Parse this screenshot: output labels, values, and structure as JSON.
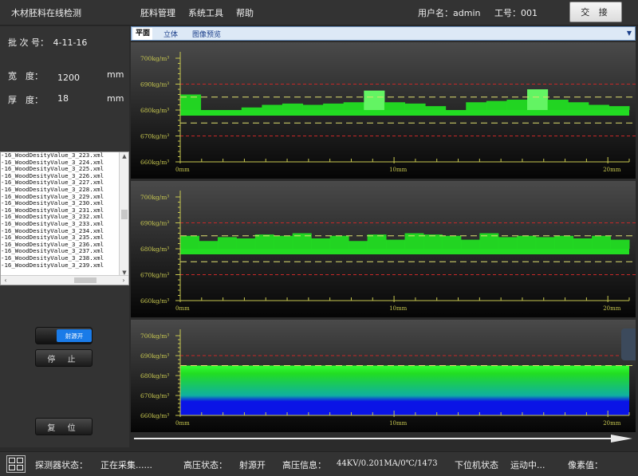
{
  "app": {
    "title": "木材胚料在线检测",
    "menus": [
      "胚料管理",
      "系统工具",
      "帮助"
    ],
    "user_label": "用户名：admin",
    "worker_label": "工号：001",
    "switch_button": "交 接"
  },
  "batch": {
    "label": "批 次 号：",
    "value": "4-11-16",
    "width_label": "宽　度：",
    "width_value": "1200",
    "thickness_label": "厚　度：",
    "thickness_value": "18",
    "unit": "mm"
  },
  "file_list": [
    "-16_WoodDesityValue_3_223.xml",
    "-16_WoodDesityValue_3_224.xml",
    "-16_WoodDesityValue_3_225.xml",
    "-16_WoodDesityValue_3_226.xml",
    "-16_WoodDesityValue_3_227.xml",
    "-16_WoodDesityValue_3_228.xml",
    "-16_WoodDesityValue_3_229.xml",
    "-16_WoodDesityValue_3_230.xml",
    "-16_WoodDesityValue_3_231.xml",
    "-16_WoodDesityValue_3_232.xml",
    "-16_WoodDesityValue_3_233.xml",
    "-16_WoodDesityValue_3_234.xml",
    "-16_WoodDesityValue_3_235.xml",
    "-16_WoodDesityValue_3_236.xml",
    "-16_WoodDesityValue_3_237.xml",
    "-16_WoodDesityValue_3_238.xml",
    "-16_WoodDesityValue_3_239.xml"
  ],
  "controls": {
    "source_toggle": "射源开",
    "stop_button": "停 止",
    "reset_button": "复 位"
  },
  "tabs": [
    {
      "label": "平面",
      "active": true
    },
    {
      "label": "立体",
      "active": false
    },
    {
      "label": "图像预览",
      "active": false
    }
  ],
  "status": {
    "detector_label": "探测器状态：",
    "detector_value": "正在采集......",
    "hv_label": "高压状态：",
    "hv_value": "射源开",
    "hv_info_label": "高压信息：",
    "hv_info_value": "44KV/0.201MA/0℃/1473",
    "plc_label": "下位机状态",
    "plc_value": "运动中...",
    "pixel_label": "像素值："
  },
  "colors": {
    "bar_green": "#22dd22",
    "bar_light": "#66ff66",
    "limit_red": "#c82828",
    "limit_yellow": "#e0e070",
    "axis": "#c8c850",
    "blue": "#0a14e6",
    "tab_text": "#1a3e8a"
  },
  "chart_data": [
    {
      "type": "bar",
      "title": "",
      "y_ticks": [
        "700kg/m³",
        "690kg/m³",
        "680kg/m³",
        "670kg/m³",
        "660kg/m³"
      ],
      "ylim": [
        660,
        700
      ],
      "x_ticks": [
        "0mm",
        "10mm",
        "20mm"
      ],
      "xlim": [
        0,
        21
      ],
      "baseline": 680,
      "upper_yellow": 685,
      "lower_yellow": 675,
      "upper_red": 690,
      "lower_red": 670,
      "values": [
        686,
        679.5,
        679,
        681,
        682,
        682.5,
        682,
        682.5,
        683,
        687.5,
        683,
        682.5,
        681.5,
        680,
        683,
        683.5,
        684,
        688,
        684,
        683,
        682,
        681.5
      ]
    },
    {
      "type": "bar",
      "title": "",
      "y_ticks": [
        "700kg/m³",
        "690kg/m³",
        "680kg/m³",
        "670kg/m³",
        "660kg/m³"
      ],
      "ylim": [
        660,
        700
      ],
      "x_ticks": [
        "0mm",
        "10mm",
        "20mm"
      ],
      "xlim": [
        0,
        21
      ],
      "baseline": 680,
      "upper_yellow": 685,
      "lower_yellow": 675,
      "upper_red": 690,
      "lower_red": 670,
      "values": [
        685,
        683,
        684.5,
        684,
        685.5,
        685,
        686,
        684,
        685,
        683,
        685.5,
        683.5,
        686,
        685.5,
        685,
        683.5,
        686,
        684.5,
        685,
        684.5,
        685,
        684,
        685,
        683.5
      ]
    },
    {
      "type": "heatmap",
      "title": "",
      "y_ticks": [
        "700kg/m³",
        "690kg/m³",
        "680kg/m³",
        "670kg/m³",
        "660kg/m³"
      ],
      "ylim": [
        660,
        700
      ],
      "x_ticks": [
        "0mm",
        "10mm",
        "20mm"
      ],
      "xlim": [
        0,
        21
      ],
      "upper_yellow": 685,
      "upper_red": 690,
      "green_top": 681,
      "blue_bottom_start": 670
    }
  ]
}
